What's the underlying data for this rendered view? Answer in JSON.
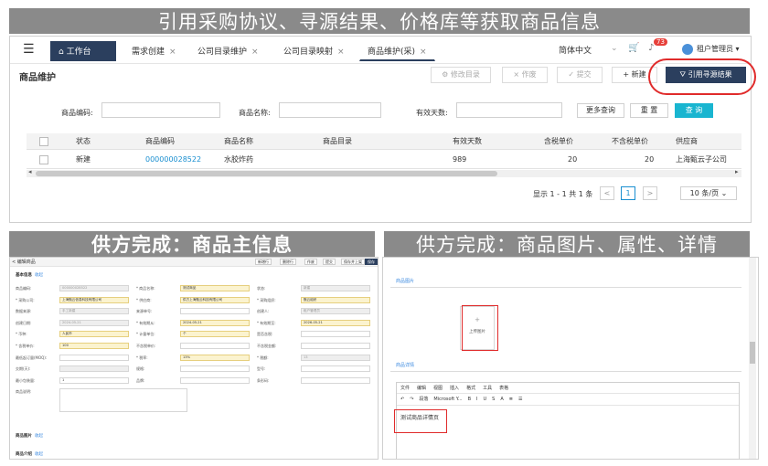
{
  "banners": {
    "top": "引用采购协议、寻源结果、价格库等获取商品信息",
    "left": "供方完成：商品主信息",
    "right": "供方完成：商品图片、属性、详情"
  },
  "topbar": {
    "tabs": [
      {
        "label": "工作台"
      },
      {
        "label": "需求创建"
      },
      {
        "label": "公司目录维护"
      },
      {
        "label": "公司目录映射"
      },
      {
        "label": "商品维护(采)"
      }
    ],
    "close_glyph": "×",
    "language": "简体中文",
    "notification_count": "73",
    "user": "租户管理员"
  },
  "page": {
    "title": "商品维护",
    "actions": {
      "edit": "修改目录",
      "void": "作废",
      "submit": "提交",
      "new": "新建",
      "quote": "引用寻源结果"
    }
  },
  "filters": {
    "code_label": "商品编码:",
    "name_label": "商品名称:",
    "days_label": "有效天数:",
    "more": "更多查询",
    "reset": "重 置",
    "query": "查 询"
  },
  "table": {
    "headers": [
      "状态",
      "商品编码",
      "商品名称",
      "商品目录",
      "有效天数",
      "含税单价",
      "不含税单价",
      "供应商"
    ],
    "rows": [
      {
        "status": "新建",
        "code": "000000028522",
        "name": "水胶炸药",
        "catalog": "",
        "days": "989",
        "tax_price": "20",
        "notax_price": "20",
        "supplier": "上海甄云子公司"
      }
    ]
  },
  "pager": {
    "summary": "显示 1 - 1 共 1 条",
    "prev": "<",
    "current": "1",
    "next": ">",
    "page_size": "10 条/页"
  },
  "main_info": {
    "header": {
      "back": "< 编辑商品",
      "buttons": [
        "新增行",
        "删除行",
        "作废",
        "提交",
        "保存并上架",
        "保存"
      ]
    },
    "section_basic": "基本信息",
    "collapse_label": "收起",
    "fields": [
      {
        "label": "商品编码:",
        "value": "000000028522",
        "style": "dis"
      },
      {
        "label": "* 商品名称:",
        "value": "测试商品",
        "style": "req"
      },
      {
        "label": "状态:",
        "value": "新建",
        "style": "dis"
      },
      {
        "label": "* 采购公司:",
        "value": "上海甄云信息科技有限公司",
        "style": "req"
      },
      {
        "label": "* 供应商:",
        "value": "供方上海甄云科技有限公司",
        "style": "req"
      },
      {
        "label": "* 采购组织:",
        "value": "甄云组织",
        "style": "req"
      },
      {
        "label": "数据来源:",
        "value": "手工新建",
        "style": "dis"
      },
      {
        "label": "来源单号:",
        "value": "",
        "style": ""
      },
      {
        "label": "创建人:",
        "value": "租户管理员",
        "style": "dis"
      },
      {
        "label": "创建日期:",
        "value": "2024-05-21",
        "style": "dis"
      },
      {
        "label": "* 有效期从:",
        "value": "2024-05-21",
        "style": "req"
      },
      {
        "label": "* 有效期至:",
        "value": "2026-05-21",
        "style": "req"
      },
      {
        "label": "* 币种:",
        "value": "人民币",
        "style": "req"
      },
      {
        "label": "* 计量单位:",
        "value": "个",
        "style": "req"
      },
      {
        "label": "是否含税:",
        "value": "",
        "style": ""
      },
      {
        "label": "* 含税单价:",
        "value": "100",
        "style": "req"
      },
      {
        "label": "不含税单价:",
        "value": "",
        "style": ""
      },
      {
        "label": "不含税金额:",
        "value": "",
        "style": ""
      },
      {
        "label": "最低起订量(MOQ):",
        "value": "",
        "style": ""
      },
      {
        "label": "* 税率:",
        "value": "13%",
        "style": "req"
      },
      {
        "label": "* 税额:",
        "value": "13",
        "style": "dis"
      },
      {
        "label": "交期(天):",
        "value": "",
        "style": "dis"
      },
      {
        "label": "规格:",
        "value": "",
        "style": ""
      },
      {
        "label": "型号:",
        "value": "",
        "style": ""
      },
      {
        "label": "最小包装量:",
        "value": "1",
        "style": ""
      },
      {
        "label": "品牌:",
        "value": "",
        "style": ""
      },
      {
        "label": "条形码:",
        "value": "",
        "style": ""
      },
      {
        "label": "商品说明:",
        "value": "",
        "style": ""
      }
    ],
    "section_image": "商品图片",
    "section_attr": "商品介绍"
  },
  "detail_info": {
    "image_section": "商品图片",
    "upload_plus": "+",
    "upload_label": "上传图片",
    "detail_section": "商品详情",
    "menu": [
      "文件",
      "编辑",
      "视图",
      "插入",
      "格式",
      "工具",
      "表格"
    ],
    "tools": [
      "↶",
      "↷",
      "段落",
      "Microsoft Y...",
      "B",
      "I",
      "U",
      "S",
      "A",
      "≣",
      "☰"
    ],
    "body_text": "测试商品详情页"
  }
}
